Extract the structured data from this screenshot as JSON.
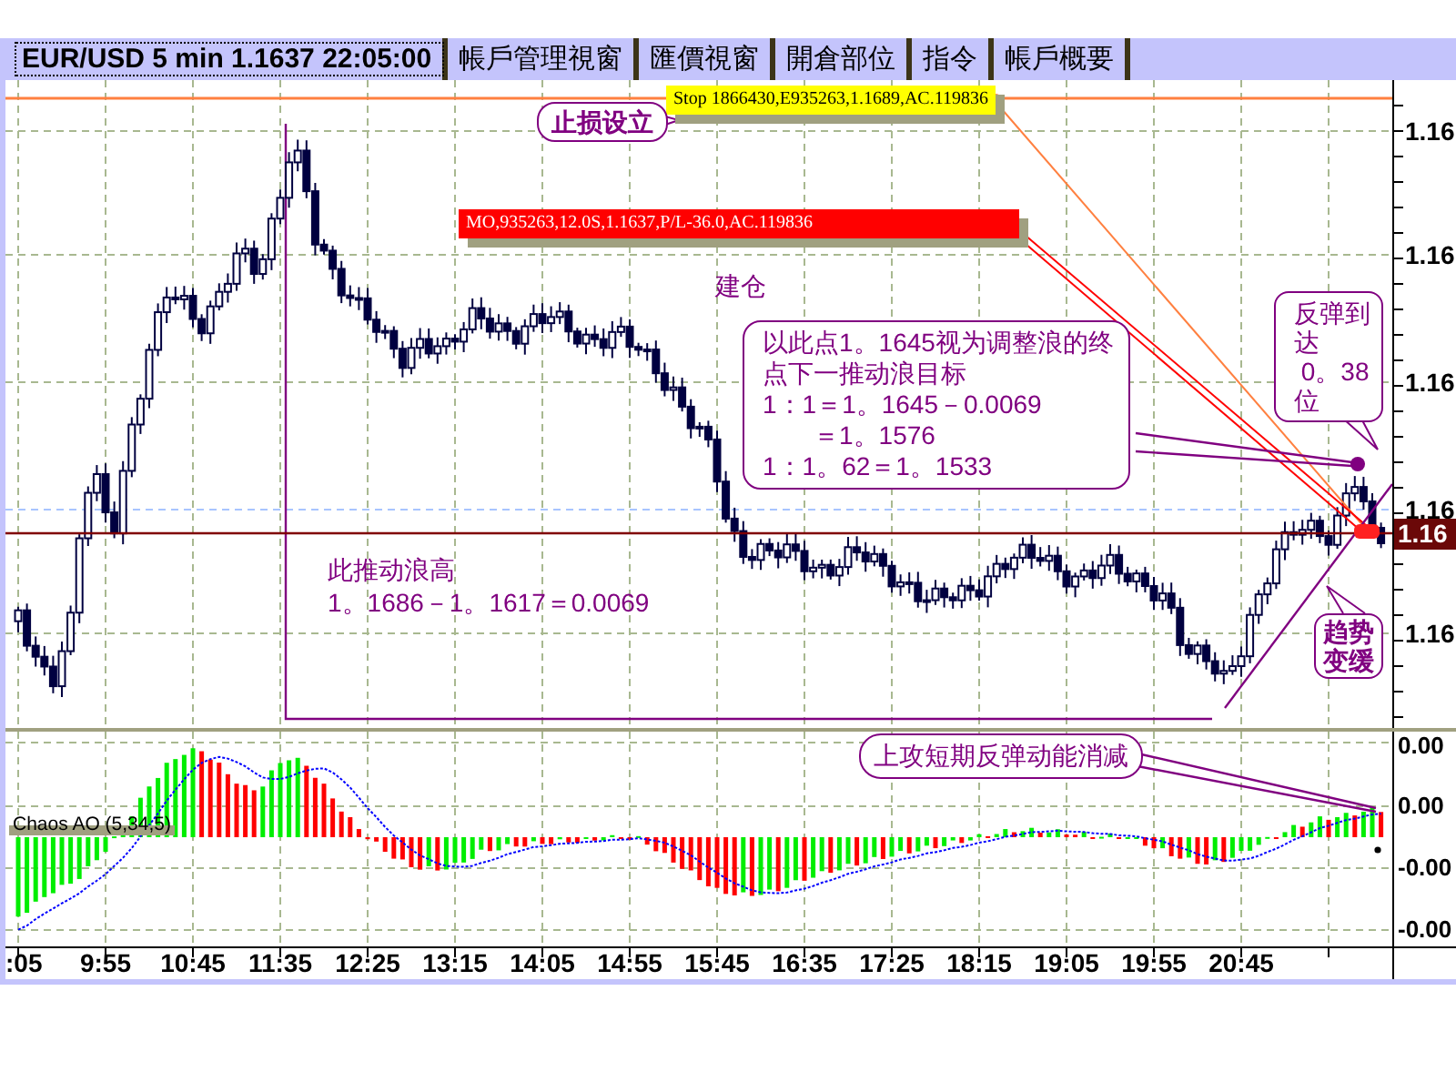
{
  "tabs": [
    {
      "label": "EUR/USD 5 min 1.1637 22:05:00",
      "selected": true
    },
    {
      "label": "帳戶管理視窗",
      "selected": false
    },
    {
      "label": "匯價視窗",
      "selected": false
    },
    {
      "label": "開倉部位",
      "selected": false
    },
    {
      "label": "指令",
      "selected": false
    },
    {
      "label": "帳戶概要",
      "selected": false
    }
  ],
  "price_panel": {
    "orders": [
      {
        "kind": "stop",
        "text": "Stop 1866430,E935263,1.1689,AC.119836"
      },
      {
        "kind": "market",
        "text": "MO,935263,12.0S,1.1637,P/L-36.0,AC.119836"
      }
    ],
    "notes": [
      {
        "kind": "callout",
        "lines": [
          "止损设立"
        ]
      },
      {
        "kind": "text",
        "lines": [
          "建仓"
        ]
      },
      {
        "kind": "callout",
        "lines": [
          "反弹到",
          "达",
          " 0。38",
          "位"
        ]
      },
      {
        "kind": "callout",
        "lines": [
          "以此点1。1645视为调整浪的终",
          "点下一推动浪目标",
          "1：1＝1。1645－0.0069",
          "　　＝1。1576",
          "1：1。62＝1。1533"
        ]
      },
      {
        "kind": "text",
        "lines": [
          "此推动浪高",
          "1。1686－1。1617＝0.0069"
        ]
      },
      {
        "kind": "callout",
        "lines": [
          "趋势",
          "变缓"
        ]
      }
    ],
    "axis_labels": [
      "1.16",
      "1.16",
      "1.16",
      "1.16",
      "1.16"
    ],
    "current_price": "1.16"
  },
  "ao_panel": {
    "title": "Chaos AO (5,34,5)",
    "notes": [
      {
        "kind": "callout",
        "lines": [
          "上攻短期反弹动能消减"
        ]
      }
    ],
    "axis_labels": [
      "0.00",
      "0.00",
      "-0.00",
      "-0.00"
    ]
  },
  "time_axis": {
    "labels": [
      ":05",
      "9:55",
      "10:45",
      "11:35",
      "12:25",
      "13:15",
      "14:05",
      "14:55",
      "15:45",
      "16:35",
      "17:25",
      "18:15",
      "19:05",
      "19:55",
      "20:45"
    ]
  }
}
